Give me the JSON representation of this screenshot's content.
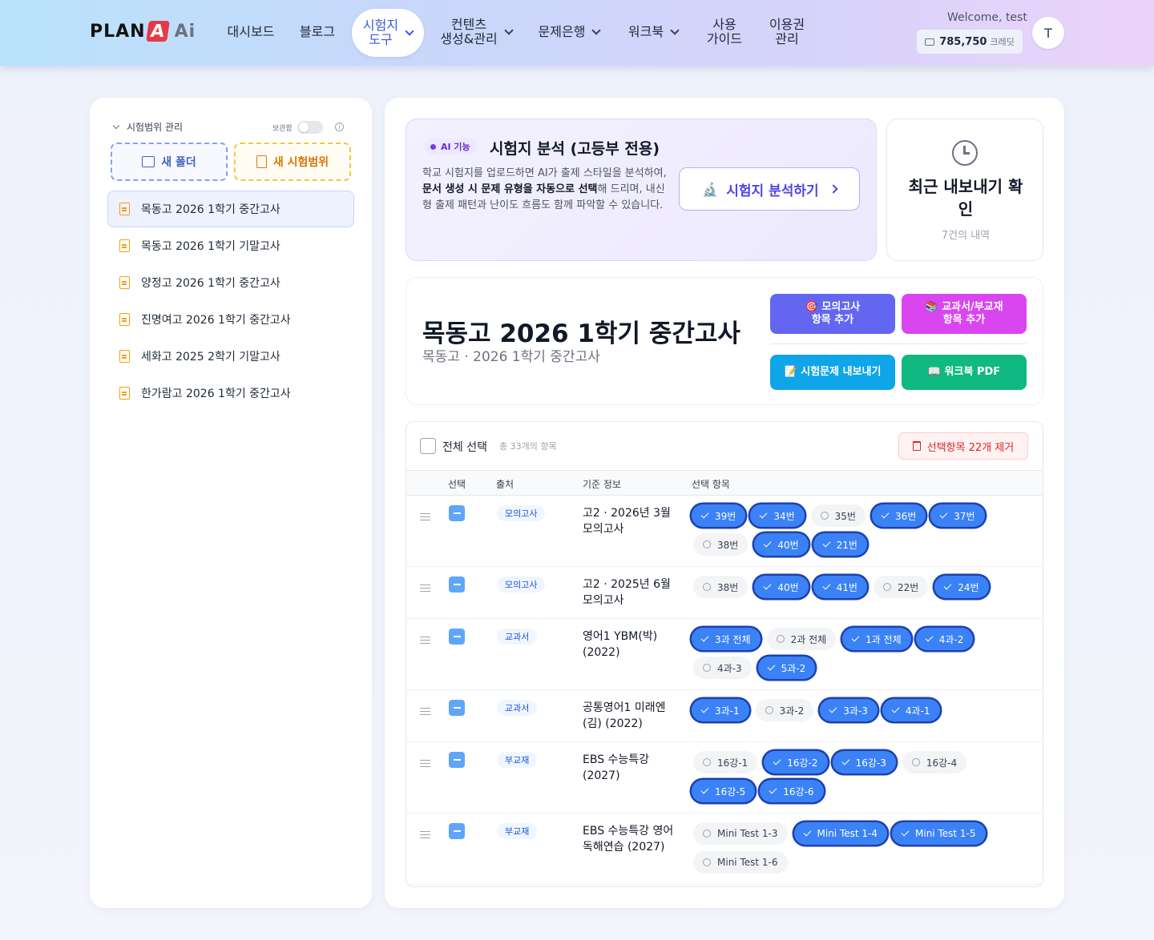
{
  "header": {
    "logo": {
      "plan": "PLAN",
      "a": "A",
      "ai": "Ai"
    },
    "nav": [
      {
        "label": "대시보드"
      },
      {
        "label": "블로그"
      },
      {
        "label_line1": "시험지",
        "label_line2": "도구",
        "active": true
      },
      {
        "label_line1": "컨텐츠",
        "label_line2": "생성&관리"
      },
      {
        "label": "문제은행"
      },
      {
        "label": "워크북"
      },
      {
        "label_line1": "사용",
        "label_line2": "가이드"
      },
      {
        "label_line1": "이용권",
        "label_line2": "관리"
      }
    ],
    "welcome": "Welcome, test",
    "credits": "785,750",
    "credits_unit": "크레딧",
    "avatar_initial": "T"
  },
  "sidebar": {
    "section_title": "시험범위 관리",
    "archive_label": "보관함",
    "new_folder": "새 폴더",
    "new_range": "새 시험범위",
    "documents": [
      {
        "label": "목동고 2026 1학기 중간고사",
        "active": true
      },
      {
        "label": "목동고 2026 1학기 기말고사"
      },
      {
        "label": "양정고 2026 1학기 중간고사"
      },
      {
        "label": "진명여고 2026 1학기 중간고사"
      },
      {
        "label": "세화고 2025 2학기 기말고사"
      },
      {
        "label": "한가람고 2026 1학기 중간고사"
      }
    ]
  },
  "ai_card": {
    "badge": "AI 기능",
    "title": "시험지 분석 (고등부 전용)",
    "desc_1": "학교 시험지를 업로드하면 AI가 출제 스타일을 분석하여,",
    "desc_bold": "문서 생성 시 문제 유형을 자동으로 선택",
    "desc_2": "해 드리며, 내신형 출제 패턴과 난이도 흐름도 함께 파악할 수 있습니다.",
    "button": "시험지 분석하기"
  },
  "recent": {
    "title": "최근 내보내기 확인",
    "count": "7건의 내역"
  },
  "exam": {
    "title": "목동고 2026 1학기 중간고사",
    "subtitle": "목동고 · 2026 1학기 중간고사",
    "btn_mock_1": "🎯 모의고사",
    "btn_mock_2": "항목 추가",
    "btn_text_1": "📚 교과서/부교재",
    "btn_text_2": "항목 추가",
    "btn_export": "📝 시험문제 내보내기",
    "btn_workbook": "📖 워크북 PDF"
  },
  "table": {
    "select_all": "전체 선택",
    "total": "총 33개의 항목",
    "delete_selected": "선택항목 22개 제거",
    "headers": {
      "select": "선택",
      "source": "출처",
      "basis": "기준 정보",
      "items": "선택 항목"
    },
    "rows": [
      {
        "source": "모의고사",
        "basis": "고2 · 2026년 3월 모의고사",
        "chips": [
          {
            "label": "39번",
            "on": true
          },
          {
            "label": "34번",
            "on": true
          },
          {
            "label": "35번",
            "on": false
          },
          {
            "label": "36번",
            "on": true
          },
          {
            "label": "37번",
            "on": true
          },
          {
            "label": "38번",
            "on": false
          },
          {
            "label": "40번",
            "on": true
          },
          {
            "label": "21번",
            "on": true
          }
        ]
      },
      {
        "source": "모의고사",
        "basis": "고2 · 2025년 6월 모의고사",
        "chips": [
          {
            "label": "38번",
            "on": false
          },
          {
            "label": "40번",
            "on": true
          },
          {
            "label": "41번",
            "on": true
          },
          {
            "label": "22번",
            "on": false
          },
          {
            "label": "24번",
            "on": true
          }
        ]
      },
      {
        "source": "교과서",
        "basis": "영어1 YBM(박) (2022)",
        "chips": [
          {
            "label": "3과 전체",
            "on": true
          },
          {
            "label": "2과 전체",
            "on": false
          },
          {
            "label": "1과 전체",
            "on": true
          },
          {
            "label": "4과-2",
            "on": true
          },
          {
            "label": "4과-3",
            "on": false
          },
          {
            "label": "5과-2",
            "on": true
          }
        ]
      },
      {
        "source": "교과서",
        "basis": "공통영어1 미래엔 (김) (2022)",
        "chips": [
          {
            "label": "3과-1",
            "on": true
          },
          {
            "label": "3과-2",
            "on": false
          },
          {
            "label": "3과-3",
            "on": true
          },
          {
            "label": "4과-1",
            "on": true
          }
        ]
      },
      {
        "source": "부교재",
        "basis": "EBS 수능특강 (2027)",
        "chips": [
          {
            "label": "16강-1",
            "on": false
          },
          {
            "label": "16강-2",
            "on": true
          },
          {
            "label": "16강-3",
            "on": true
          },
          {
            "label": "16강-4",
            "on": false
          },
          {
            "label": "16강-5",
            "on": true
          },
          {
            "label": "16강-6",
            "on": true
          }
        ]
      },
      {
        "source": "부교재",
        "basis": "EBS 수능특강 영어 독해연습 (2027)",
        "chips": [
          {
            "label": "Mini Test 1-3",
            "on": false
          },
          {
            "label": "Mini Test 1-4",
            "on": true
          },
          {
            "label": "Mini Test 1-5",
            "on": true
          },
          {
            "label": "Mini Test 1-6",
            "on": false
          }
        ]
      }
    ]
  }
}
